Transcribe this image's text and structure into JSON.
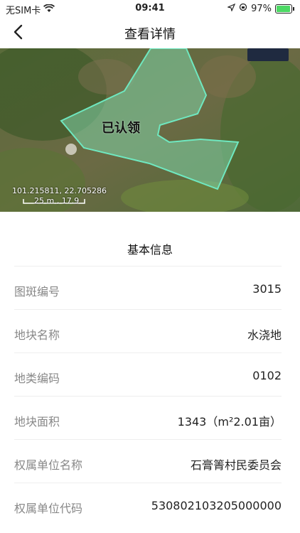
{
  "status_bar": {
    "carrier": "无SIM卡",
    "time": "09:41",
    "battery_percent": "97%",
    "battery_level": 0.97
  },
  "nav": {
    "title": "查看详情",
    "back_icon": "chevron-left-icon"
  },
  "map": {
    "polygon_label": "已认领",
    "coordinates": "101.215811, 22.705286",
    "scale_text": "25 m , 17.9",
    "colors": {
      "polygon_fill": "#7fd3a8",
      "polygon_stroke": "#6fe8c0"
    }
  },
  "basic_info": {
    "title": "基本信息",
    "rows": [
      {
        "label": "图斑编号",
        "value": "3015"
      },
      {
        "label": "地块名称",
        "value": "水浇地"
      },
      {
        "label": "地类编码",
        "value": "0102"
      },
      {
        "label": "地块面积",
        "value": "1343（m²2.01亩）"
      },
      {
        "label": "权属单位名称",
        "value": "石膏箐村民委员会"
      },
      {
        "label": "权属单位代码",
        "value": "530802103205000000"
      }
    ]
  }
}
